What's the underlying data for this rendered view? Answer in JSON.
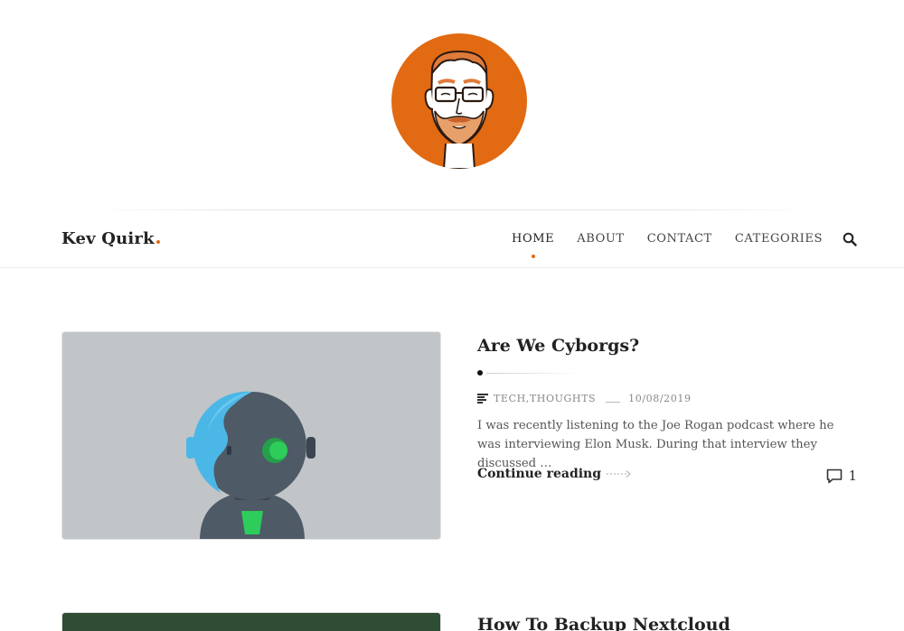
{
  "site": {
    "title": "Kev Quirk",
    "logo_alt": "Kev Quirk avatar",
    "accent": "#e26a12"
  },
  "nav": {
    "items": [
      {
        "label": "HOME",
        "active": true
      },
      {
        "label": "ABOUT",
        "active": false
      },
      {
        "label": "CONTACT",
        "active": false
      },
      {
        "label": "CATEGORIES",
        "active": false
      }
    ],
    "search_icon": "search-icon"
  },
  "posts": [
    {
      "title": "Are We Cyborgs?",
      "categories": "TECH,THOUGHTS",
      "date": "10/08/2019",
      "excerpt": "I was recently listening to the Joe Rogan podcast where he was interviewing Elon Musk. During that interview they discussed …",
      "continue_label": "Continue reading",
      "comment_count": "1",
      "image_desc": "cyborg robot illustration",
      "image_bg": "#c1c5c8"
    },
    {
      "title": "How To Backup Nextcloud",
      "image_bg": "#2f4d33"
    }
  ]
}
